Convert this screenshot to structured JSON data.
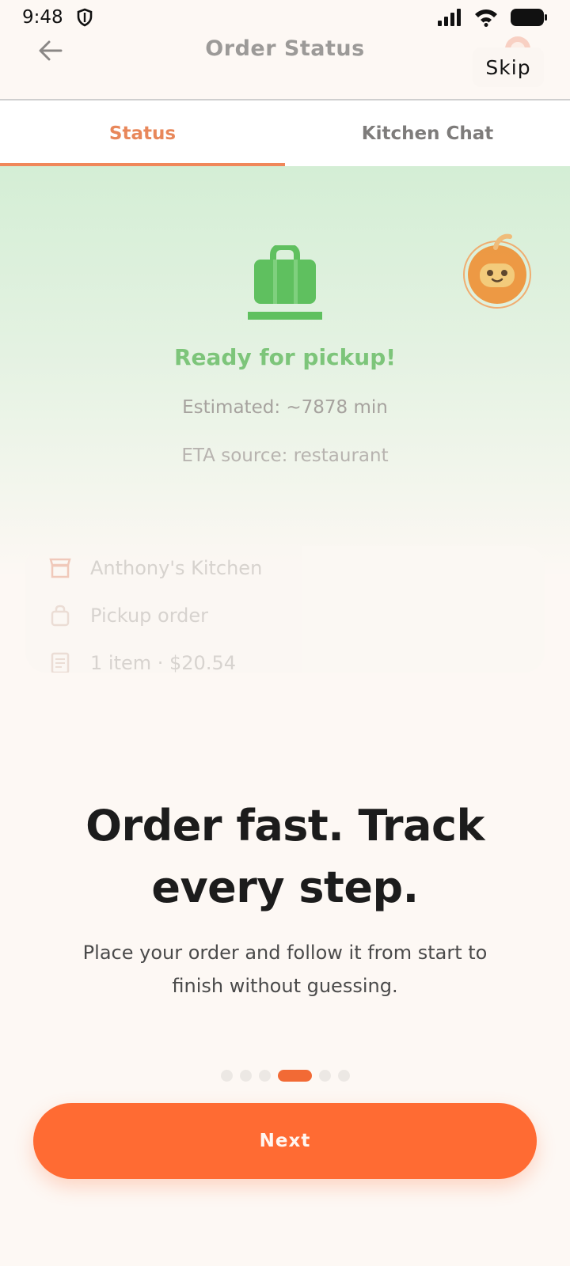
{
  "status_bar": {
    "time": "9:48",
    "icons": [
      "shield-icon",
      "signal-icon",
      "wifi-icon",
      "battery-icon"
    ]
  },
  "header": {
    "title": "Order Status",
    "skip_label": "Skip",
    "icons": [
      "back-arrow-icon",
      "avatar-icon"
    ]
  },
  "tabs": [
    {
      "label": "Status",
      "active": true
    },
    {
      "label": "Kitchen Chat",
      "active": false
    }
  ],
  "status_panel": {
    "ready_text": "Ready for pickup!",
    "eta_text": "Estimated: ~7878 min",
    "eta_source_text": "ETA source: restaurant",
    "icons": [
      "shopping-bag-icon",
      "mascot-icon"
    ]
  },
  "order_card": {
    "rows": [
      {
        "icon": "store-icon",
        "label": "Anthony's Kitchen"
      },
      {
        "icon": "bag-icon",
        "label": "Pickup order"
      },
      {
        "icon": "receipt-icon",
        "label": "1 item · $20.54"
      }
    ]
  },
  "onboarding": {
    "title_line1": "Order fast. Track",
    "title_line2": "every step.",
    "subtitle_line1": "Place your order and follow it from start to",
    "subtitle_line2": "finish without guessing.",
    "pager": {
      "total": 6,
      "active_index": 3
    },
    "next_label": "Next"
  },
  "colors": {
    "accent": "#ff6b33",
    "tab_active": "#e8875a",
    "ready_green": "#7dc57a",
    "background": "#fdf8f4"
  }
}
